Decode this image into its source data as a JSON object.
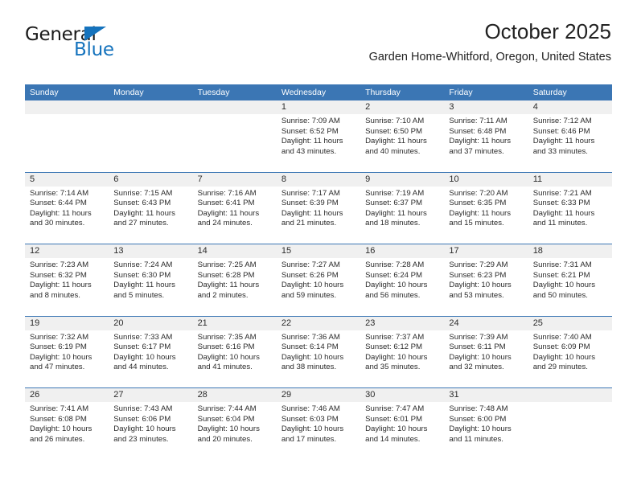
{
  "brand": {
    "name_part1": "General",
    "name_part2": "Blue",
    "accent_color": "#1573bd"
  },
  "header": {
    "title": "October 2025",
    "location": "Garden Home-Whitford, Oregon, United States",
    "header_bg_color": "#3b76b4",
    "day_band_color": "#f0f0f0"
  },
  "weekdays": [
    "Sunday",
    "Monday",
    "Tuesday",
    "Wednesday",
    "Thursday",
    "Friday",
    "Saturday"
  ],
  "weeks": [
    {
      "days": [
        {
          "num": "",
          "sunrise": "",
          "sunset": "",
          "daylight": ""
        },
        {
          "num": "",
          "sunrise": "",
          "sunset": "",
          "daylight": ""
        },
        {
          "num": "",
          "sunrise": "",
          "sunset": "",
          "daylight": ""
        },
        {
          "num": "1",
          "sunrise": "Sunrise: 7:09 AM",
          "sunset": "Sunset: 6:52 PM",
          "daylight": "Daylight: 11 hours and 43 minutes."
        },
        {
          "num": "2",
          "sunrise": "Sunrise: 7:10 AM",
          "sunset": "Sunset: 6:50 PM",
          "daylight": "Daylight: 11 hours and 40 minutes."
        },
        {
          "num": "3",
          "sunrise": "Sunrise: 7:11 AM",
          "sunset": "Sunset: 6:48 PM",
          "daylight": "Daylight: 11 hours and 37 minutes."
        },
        {
          "num": "4",
          "sunrise": "Sunrise: 7:12 AM",
          "sunset": "Sunset: 6:46 PM",
          "daylight": "Daylight: 11 hours and 33 minutes."
        }
      ]
    },
    {
      "days": [
        {
          "num": "5",
          "sunrise": "Sunrise: 7:14 AM",
          "sunset": "Sunset: 6:44 PM",
          "daylight": "Daylight: 11 hours and 30 minutes."
        },
        {
          "num": "6",
          "sunrise": "Sunrise: 7:15 AM",
          "sunset": "Sunset: 6:43 PM",
          "daylight": "Daylight: 11 hours and 27 minutes."
        },
        {
          "num": "7",
          "sunrise": "Sunrise: 7:16 AM",
          "sunset": "Sunset: 6:41 PM",
          "daylight": "Daylight: 11 hours and 24 minutes."
        },
        {
          "num": "8",
          "sunrise": "Sunrise: 7:17 AM",
          "sunset": "Sunset: 6:39 PM",
          "daylight": "Daylight: 11 hours and 21 minutes."
        },
        {
          "num": "9",
          "sunrise": "Sunrise: 7:19 AM",
          "sunset": "Sunset: 6:37 PM",
          "daylight": "Daylight: 11 hours and 18 minutes."
        },
        {
          "num": "10",
          "sunrise": "Sunrise: 7:20 AM",
          "sunset": "Sunset: 6:35 PM",
          "daylight": "Daylight: 11 hours and 15 minutes."
        },
        {
          "num": "11",
          "sunrise": "Sunrise: 7:21 AM",
          "sunset": "Sunset: 6:33 PM",
          "daylight": "Daylight: 11 hours and 11 minutes."
        }
      ]
    },
    {
      "days": [
        {
          "num": "12",
          "sunrise": "Sunrise: 7:23 AM",
          "sunset": "Sunset: 6:32 PM",
          "daylight": "Daylight: 11 hours and 8 minutes."
        },
        {
          "num": "13",
          "sunrise": "Sunrise: 7:24 AM",
          "sunset": "Sunset: 6:30 PM",
          "daylight": "Daylight: 11 hours and 5 minutes."
        },
        {
          "num": "14",
          "sunrise": "Sunrise: 7:25 AM",
          "sunset": "Sunset: 6:28 PM",
          "daylight": "Daylight: 11 hours and 2 minutes."
        },
        {
          "num": "15",
          "sunrise": "Sunrise: 7:27 AM",
          "sunset": "Sunset: 6:26 PM",
          "daylight": "Daylight: 10 hours and 59 minutes."
        },
        {
          "num": "16",
          "sunrise": "Sunrise: 7:28 AM",
          "sunset": "Sunset: 6:24 PM",
          "daylight": "Daylight: 10 hours and 56 minutes."
        },
        {
          "num": "17",
          "sunrise": "Sunrise: 7:29 AM",
          "sunset": "Sunset: 6:23 PM",
          "daylight": "Daylight: 10 hours and 53 minutes."
        },
        {
          "num": "18",
          "sunrise": "Sunrise: 7:31 AM",
          "sunset": "Sunset: 6:21 PM",
          "daylight": "Daylight: 10 hours and 50 minutes."
        }
      ]
    },
    {
      "days": [
        {
          "num": "19",
          "sunrise": "Sunrise: 7:32 AM",
          "sunset": "Sunset: 6:19 PM",
          "daylight": "Daylight: 10 hours and 47 minutes."
        },
        {
          "num": "20",
          "sunrise": "Sunrise: 7:33 AM",
          "sunset": "Sunset: 6:17 PM",
          "daylight": "Daylight: 10 hours and 44 minutes."
        },
        {
          "num": "21",
          "sunrise": "Sunrise: 7:35 AM",
          "sunset": "Sunset: 6:16 PM",
          "daylight": "Daylight: 10 hours and 41 minutes."
        },
        {
          "num": "22",
          "sunrise": "Sunrise: 7:36 AM",
          "sunset": "Sunset: 6:14 PM",
          "daylight": "Daylight: 10 hours and 38 minutes."
        },
        {
          "num": "23",
          "sunrise": "Sunrise: 7:37 AM",
          "sunset": "Sunset: 6:12 PM",
          "daylight": "Daylight: 10 hours and 35 minutes."
        },
        {
          "num": "24",
          "sunrise": "Sunrise: 7:39 AM",
          "sunset": "Sunset: 6:11 PM",
          "daylight": "Daylight: 10 hours and 32 minutes."
        },
        {
          "num": "25",
          "sunrise": "Sunrise: 7:40 AM",
          "sunset": "Sunset: 6:09 PM",
          "daylight": "Daylight: 10 hours and 29 minutes."
        }
      ]
    },
    {
      "days": [
        {
          "num": "26",
          "sunrise": "Sunrise: 7:41 AM",
          "sunset": "Sunset: 6:08 PM",
          "daylight": "Daylight: 10 hours and 26 minutes."
        },
        {
          "num": "27",
          "sunrise": "Sunrise: 7:43 AM",
          "sunset": "Sunset: 6:06 PM",
          "daylight": "Daylight: 10 hours and 23 minutes."
        },
        {
          "num": "28",
          "sunrise": "Sunrise: 7:44 AM",
          "sunset": "Sunset: 6:04 PM",
          "daylight": "Daylight: 10 hours and 20 minutes."
        },
        {
          "num": "29",
          "sunrise": "Sunrise: 7:46 AM",
          "sunset": "Sunset: 6:03 PM",
          "daylight": "Daylight: 10 hours and 17 minutes."
        },
        {
          "num": "30",
          "sunrise": "Sunrise: 7:47 AM",
          "sunset": "Sunset: 6:01 PM",
          "daylight": "Daylight: 10 hours and 14 minutes."
        },
        {
          "num": "31",
          "sunrise": "Sunrise: 7:48 AM",
          "sunset": "Sunset: 6:00 PM",
          "daylight": "Daylight: 10 hours and 11 minutes."
        },
        {
          "num": "",
          "sunrise": "",
          "sunset": "",
          "daylight": ""
        }
      ]
    }
  ]
}
